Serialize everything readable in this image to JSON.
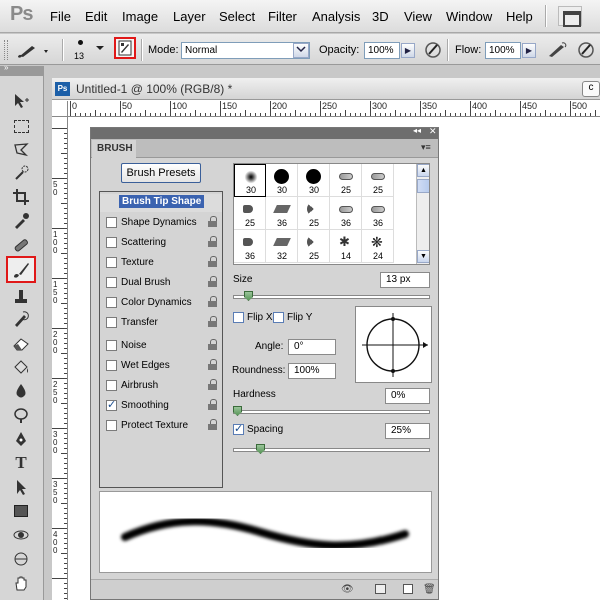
{
  "menubar": {
    "logo": "Ps",
    "items": [
      "File",
      "Edit",
      "Image",
      "Layer",
      "Select",
      "Filter",
      "Analysis",
      "3D",
      "View",
      "Window",
      "Help"
    ]
  },
  "options_bar": {
    "brush_size": "13",
    "mode_label": "Mode:",
    "mode_value": "Normal",
    "opacity_label": "Opacity:",
    "opacity_value": "100%",
    "flow_label": "Flow:",
    "flow_value": "100%"
  },
  "document": {
    "ps_icon": "Ps",
    "title": "Untitled-1 @ 100% (RGB/8) *",
    "hruler_labels": [
      "0",
      "50",
      "100",
      "150",
      "200",
      "250",
      "300",
      "350",
      "400",
      "450",
      "500"
    ],
    "vruler_labels": [
      "5\n0",
      "1\n0\n0",
      "1\n5\n0",
      "2\n0\n0",
      "2\n5\n0",
      "3\n0\n0",
      "3\n5\n0",
      "4\n0\n0"
    ]
  },
  "brush_panel": {
    "tab_label": "BRUSH",
    "presets_button": "Brush Presets",
    "options": [
      {
        "label": "Brush Tip Shape",
        "checkbox": false,
        "checked": false,
        "lock": false,
        "selected": true
      },
      {
        "label": "Shape Dynamics",
        "checkbox": true,
        "checked": false,
        "lock": true
      },
      {
        "label": "Scattering",
        "checkbox": true,
        "checked": false,
        "lock": true
      },
      {
        "label": "Texture",
        "checkbox": true,
        "checked": false,
        "lock": true
      },
      {
        "label": "Dual Brush",
        "checkbox": true,
        "checked": false,
        "lock": true
      },
      {
        "label": "Color Dynamics",
        "checkbox": true,
        "checked": false,
        "lock": true
      },
      {
        "label": "Transfer",
        "checkbox": true,
        "checked": false,
        "lock": true
      },
      {
        "label": "Noise",
        "checkbox": true,
        "checked": false,
        "lock": true
      },
      {
        "label": "Wet Edges",
        "checkbox": true,
        "checked": false,
        "lock": true
      },
      {
        "label": "Airbrush",
        "checkbox": true,
        "checked": false,
        "lock": true
      },
      {
        "label": "Smoothing",
        "checkbox": true,
        "checked": true,
        "lock": true
      },
      {
        "label": "Protect Texture",
        "checkbox": true,
        "checked": false,
        "lock": true
      }
    ],
    "tips": [
      {
        "size": "30",
        "shape": "soft-round"
      },
      {
        "size": "30",
        "shape": "hard-round"
      },
      {
        "size": "30",
        "shape": "hard-round"
      },
      {
        "size": "25",
        "shape": "chalk"
      },
      {
        "size": "25",
        "shape": "chalk"
      },
      {
        "size": "25",
        "shape": "flat"
      },
      {
        "size": "36",
        "shape": "angled"
      },
      {
        "size": "25",
        "shape": "fan"
      },
      {
        "size": "36",
        "shape": "chalk"
      },
      {
        "size": "36",
        "shape": "chalk"
      },
      {
        "size": "36",
        "shape": "flat"
      },
      {
        "size": "32",
        "shape": "angled"
      },
      {
        "size": "25",
        "shape": "fan"
      },
      {
        "size": "14",
        "shape": "star"
      },
      {
        "size": "24",
        "shape": "splatter"
      }
    ],
    "size_label": "Size",
    "size_value": "13 px",
    "size_level": 0.06,
    "flip_x_label": "Flip X",
    "flip_y_label": "Flip Y",
    "angle_label": "Angle:",
    "angle_value": "0°",
    "roundness_label": "Roundness:",
    "roundness_value": "100%",
    "hardness_label": "Hardness",
    "hardness_value": "0%",
    "hardness_level": 0,
    "spacing_label": "Spacing",
    "spacing_value": "25%",
    "spacing_checked": true,
    "spacing_level": 0.12
  },
  "colors": {
    "highlight": "#e01818",
    "selection": "#3b63b0"
  }
}
